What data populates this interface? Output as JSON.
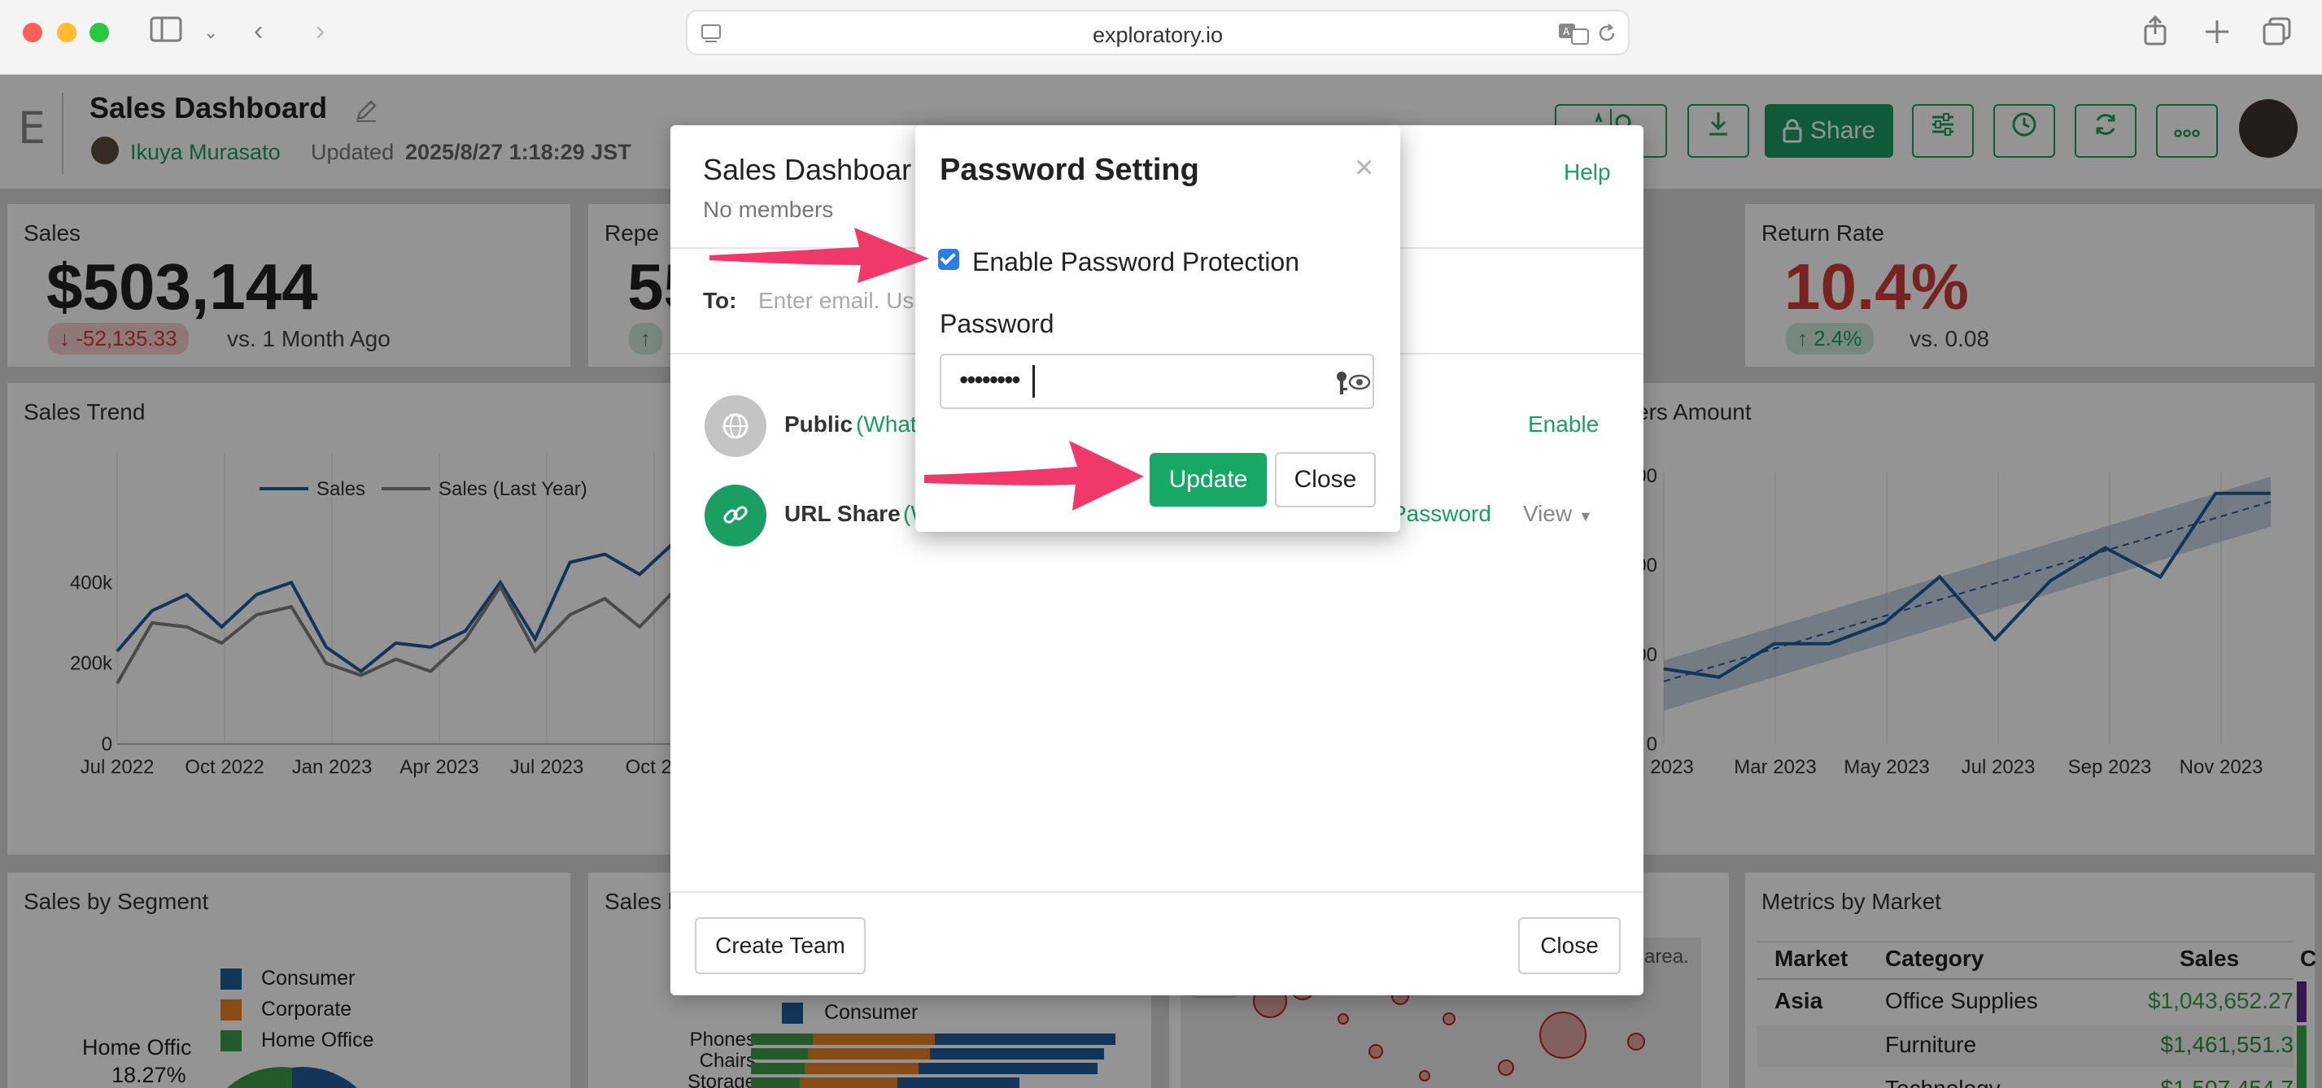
{
  "browser": {
    "url": "exploratory.io"
  },
  "app": {
    "logo": "E",
    "dashboard_title": "Sales Dashboard",
    "author": "Ikuya Murasato",
    "updated_label": "Updated",
    "updated_value": "2025/8/27 1:18:29 JST",
    "share_label": "Share"
  },
  "kpis": {
    "sales": {
      "title": "Sales",
      "value": "$503,144",
      "delta": "-52,135.33",
      "compare": "vs. 1 Month Ago"
    },
    "repeat": {
      "title": "Repe",
      "value": "55"
    },
    "return_rate": {
      "title": "Return Rate",
      "value": "10.4%",
      "delta": "2.4%",
      "compare": "vs. 0.08"
    }
  },
  "panels": {
    "sales_trend": "Sales Trend",
    "right_chart": "ers Amount",
    "by_segment": "Sales by Segment",
    "by_seg2": "Sales b",
    "metrics": "Metrics by Market"
  },
  "chart_data": [
    {
      "type": "line",
      "title": "Sales Trend",
      "legend": [
        "Sales",
        "Sales (Last Year)"
      ],
      "x_ticks": [
        "Jul 2022",
        "Oct 2022",
        "Jan 2023",
        "Apr 2023",
        "Jul 2023",
        "Oct 20"
      ],
      "y_ticks": [
        "0",
        "200k",
        "400k"
      ],
      "ylim": [
        0,
        600000
      ],
      "series": [
        {
          "name": "Sales",
          "values": [
            230000,
            330000,
            370000,
            290000,
            370000,
            400000,
            240000,
            180000,
            250000,
            240000,
            280000,
            400000,
            260000,
            450000,
            470000,
            420000,
            500000
          ]
        },
        {
          "name": "Sales (Last Year)",
          "values": [
            150000,
            300000,
            290000,
            250000,
            320000,
            340000,
            200000,
            170000,
            210000,
            180000,
            260000,
            390000,
            230000,
            320000,
            360000,
            290000,
            380000
          ]
        }
      ]
    },
    {
      "type": "line",
      "title": "ers Amount",
      "x_ticks": [
        "n 2023",
        "Mar 2023",
        "May 2023",
        "Jul 2023",
        "Sep 2023",
        "Nov 2023"
      ],
      "y_ticks": [
        "0",
        "00",
        "00",
        "00"
      ],
      "series": [
        {
          "name": "",
          "values": [
            180000,
            160000,
            240000,
            240000,
            290000,
            400000,
            250000,
            390000,
            470000,
            400000,
            600000,
            600000
          ]
        }
      ]
    }
  ],
  "segment_legend": [
    "Consumer",
    "Corporate",
    "Home Office"
  ],
  "segment_pie_label": "Home Offic",
  "segment_pie_pct": "18.27%",
  "bar_legend": "Consumer",
  "bar_categories": [
    "Phones",
    "Chairs",
    "Storage"
  ],
  "map": {
    "zoom_out": "−",
    "note": "area."
  },
  "metrics_table": {
    "headers": [
      "Market",
      "Category",
      "Sales",
      "C"
    ],
    "rows": [
      {
        "market": "Asia",
        "category": "Office Supplies",
        "sales": "$1,043,652.27"
      },
      {
        "market": "",
        "category": "Furniture",
        "sales": "$1,461,551.3"
      },
      {
        "market": "",
        "category": "Technology",
        "sales": "$1,507,454.7"
      }
    ]
  },
  "share_dialog": {
    "title": "Sales Dashboar",
    "members": "No members",
    "help": "Help",
    "to_label": "To:",
    "to_placeholder": "Enter email. Us",
    "public_label": "Public",
    "public_link": "(What",
    "public_action": "Enable",
    "url_label": "URL Share",
    "url_link": "(W",
    "url_password": "Password",
    "url_view": "View",
    "create_team": "Create Team",
    "close": "Close"
  },
  "password_modal": {
    "title": "Password Setting",
    "checkbox_label": "Enable Password Protection",
    "password_label": "Password",
    "password_value": "••••••••",
    "update": "Update",
    "close": "Close"
  },
  "colors": {
    "brand_green": "#1a9e62",
    "sales_line": "#1f5c99",
    "last_year_line": "#808080",
    "arrow_pink": "#f0386b",
    "negative_red": "#d13b3b"
  }
}
